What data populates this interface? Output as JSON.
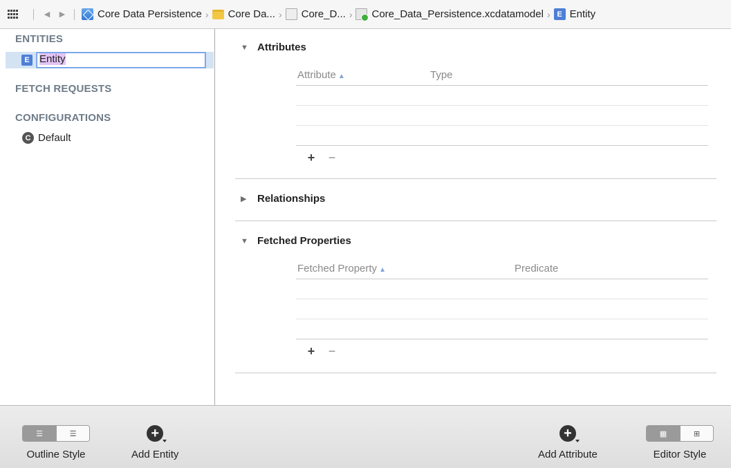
{
  "jumpbar": {
    "crumbs": [
      {
        "label": "Core Data Persistence",
        "icon": "project-icon"
      },
      {
        "label": "Core Da...",
        "icon": "folder-icon"
      },
      {
        "label": "Core_D...",
        "icon": "group-icon"
      },
      {
        "label": "Core_Data_Persistence.xcdatamodel",
        "icon": "datamodel-icon"
      },
      {
        "label": "Entity",
        "icon": "entity-icon"
      }
    ],
    "separator": "›"
  },
  "sidebar": {
    "entities_header": "ENTITIES",
    "entity_badge": "E",
    "entity_name": "Entity",
    "fetch_requests_header": "FETCH REQUESTS",
    "configurations_header": "CONFIGURATIONS",
    "config_badge": "C",
    "config_name": "Default"
  },
  "main": {
    "attributes": {
      "title": "Attributes",
      "col1": "Attribute",
      "col2": "Type"
    },
    "relationships": {
      "title": "Relationships"
    },
    "fetched_properties": {
      "title": "Fetched Properties",
      "col1": "Fetched Property",
      "col2": "Predicate"
    },
    "plus": "+",
    "minus": "−"
  },
  "toolbar": {
    "outline_style_label": "Outline Style",
    "add_entity_label": "Add Entity",
    "add_attribute_label": "Add Attribute",
    "editor_style_label": "Editor Style"
  },
  "colors": {
    "selection": "#d4e3f4",
    "header_gray": "#6e7b88",
    "entity_blue": "#4e7fd6"
  }
}
